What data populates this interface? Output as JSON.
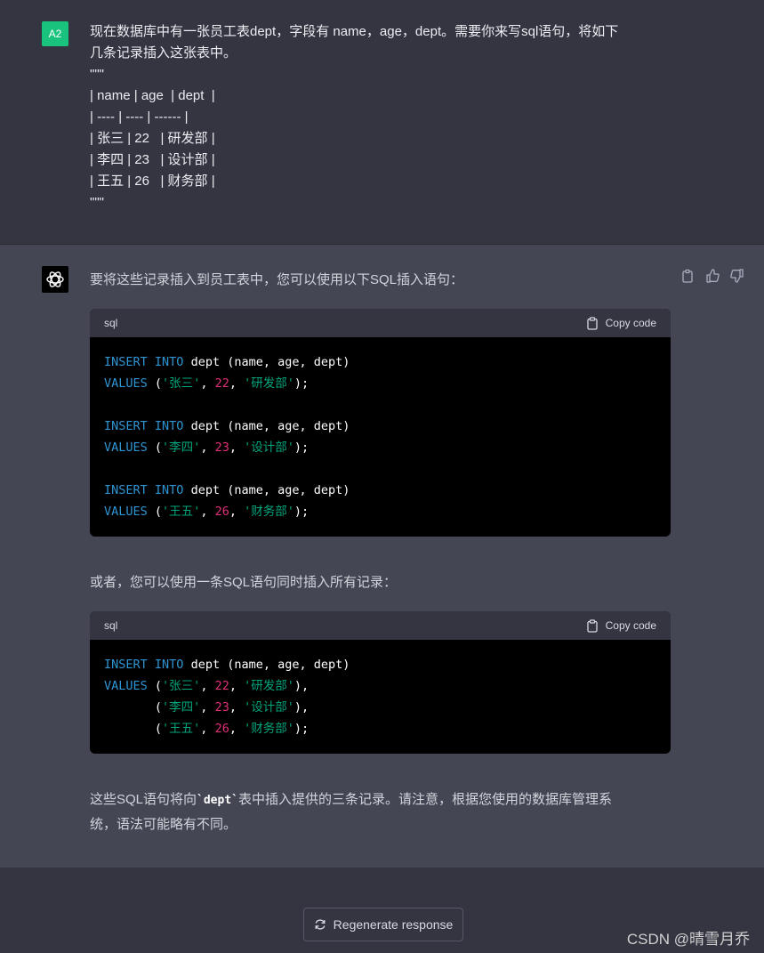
{
  "user": {
    "avatar": "A2",
    "lines": [
      "现在数据库中有一张员工表dept，字段有 name，age，dept。需要你来写sql语句，将如下",
      "几条记录插入这张表中。",
      "\"\"\"",
      "| name | age  | dept  |",
      "| ---- | ---- | ------ |",
      "| 张三 | 22   | 研发部 |",
      "| 李四 | 23   | 设计部 |",
      "| 王五 | 26   | 财务部 |",
      "\"\"\""
    ]
  },
  "assistant": {
    "intro": "要将这些记录插入到员工表中，您可以使用以下SQL插入语句：",
    "block1": {
      "lang": "sql",
      "copy_label": "Copy code",
      "statements": [
        {
          "name": "'张三'",
          "age": "22",
          "dept": "'研发部'"
        },
        {
          "name": "'李四'",
          "age": "23",
          "dept": "'设计部'"
        },
        {
          "name": "'王五'",
          "age": "26",
          "dept": "'财务部'"
        }
      ]
    },
    "middle": "或者，您可以使用一条SQL语句同时插入所有记录：",
    "block2": {
      "lang": "sql",
      "copy_label": "Copy code"
    },
    "sql": {
      "insert": "INSERT",
      "into": "INTO",
      "table_cols": "dept (name, age, dept)",
      "values": "VALUES"
    },
    "outro_before": "这些SQL语句将向",
    "outro_code": "`dept`",
    "outro_after": "表中插入提供的三条记录。请注意，根据您使用的数据库管理系",
    "outro_line2": "统，语法可能略有不同。"
  },
  "regen_label": "Regenerate response",
  "watermark": "CSDN @晴雪月乔"
}
